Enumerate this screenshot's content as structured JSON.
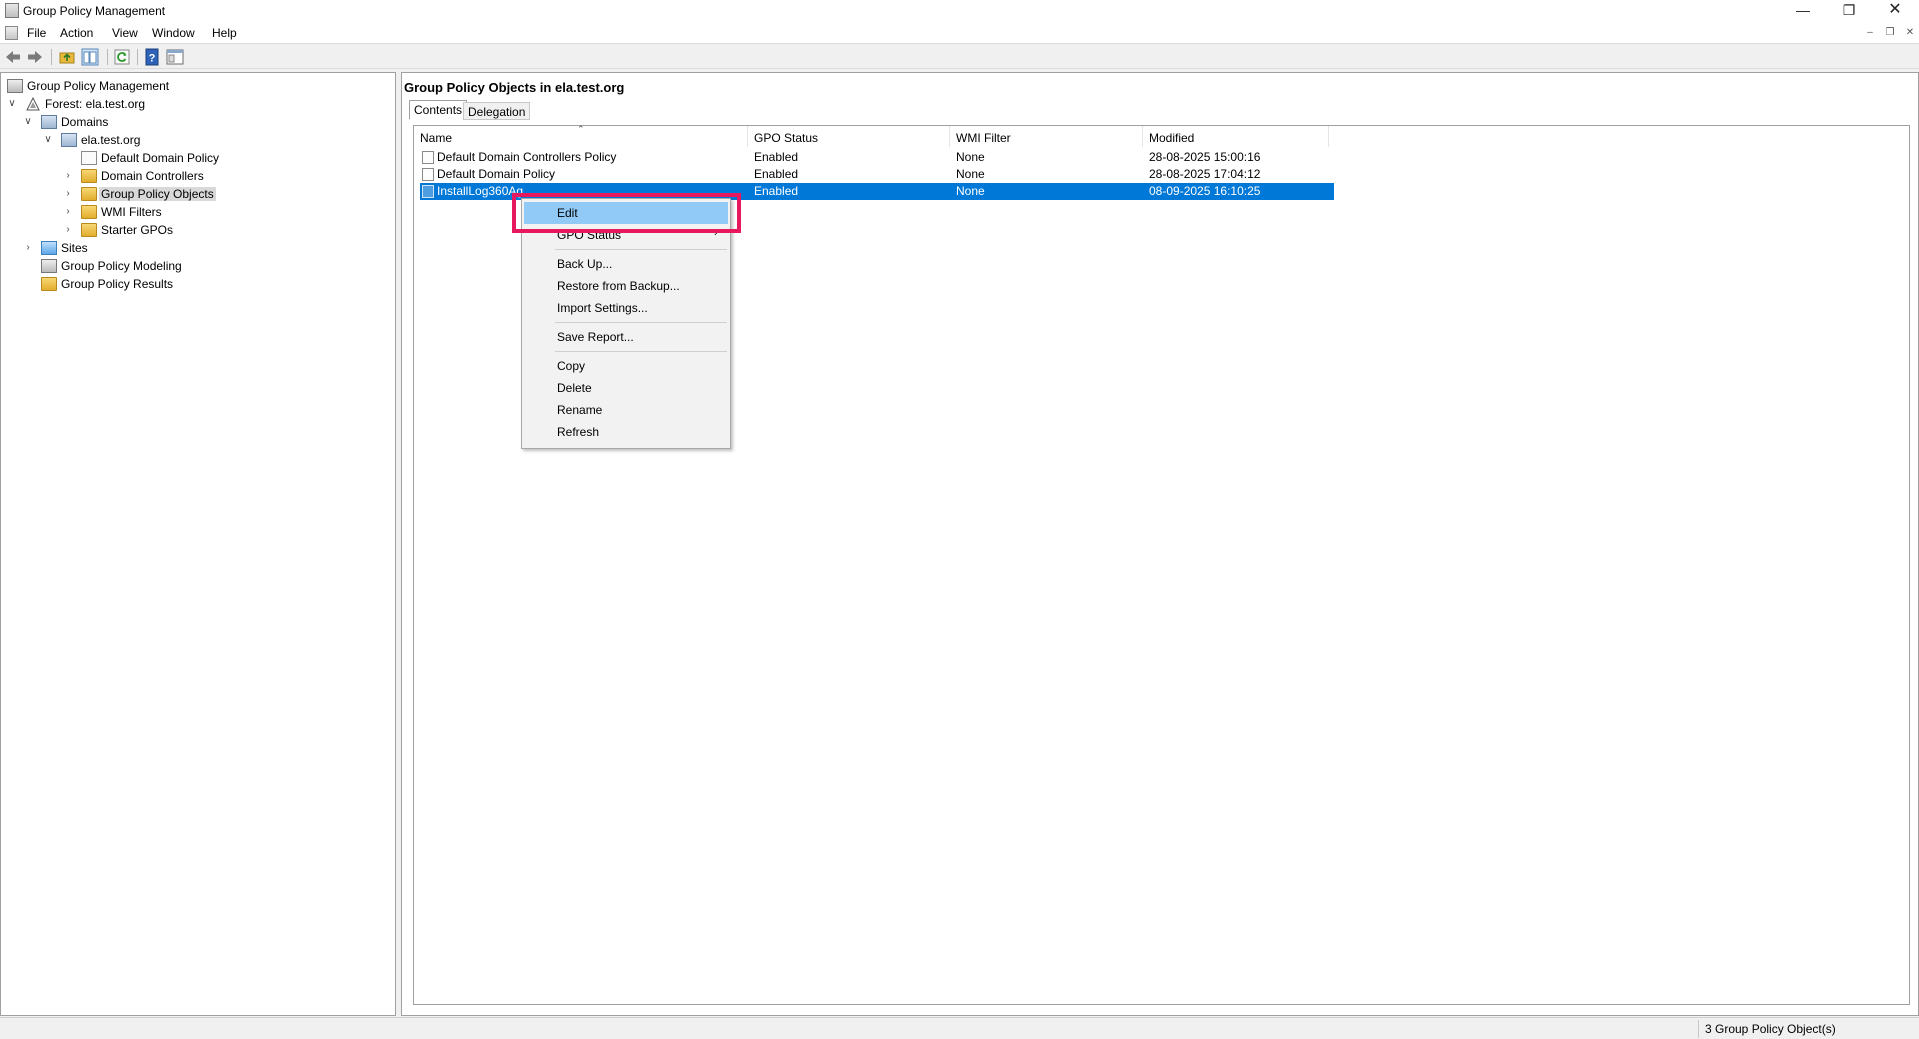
{
  "window": {
    "title": "Group Policy Management"
  },
  "menu": [
    "File",
    "Action",
    "View",
    "Window",
    "Help"
  ],
  "tree": {
    "root": "Group Policy Management",
    "forest": "Forest: ela.test.org",
    "domains": "Domains",
    "domain": "ela.test.org",
    "default_domain_policy": "Default Domain Policy",
    "domain_controllers": "Domain Controllers",
    "group_policy_objects": "Group Policy Objects",
    "wmi_filters": "WMI Filters",
    "starter_gpos": "Starter GPOs",
    "sites": "Sites",
    "modeling": "Group Policy Modeling",
    "results": "Group Policy Results"
  },
  "main": {
    "title": "Group Policy Objects in ela.test.org",
    "tabs": [
      "Contents",
      "Delegation"
    ],
    "columns": [
      "Name",
      "GPO Status",
      "WMI Filter",
      "Modified"
    ],
    "rows": [
      {
        "name": "Default Domain Controllers Policy",
        "status": "Enabled",
        "wmi": "None",
        "modified": "28-08-2025 15:00:16"
      },
      {
        "name": "Default Domain Policy",
        "status": "Enabled",
        "wmi": "None",
        "modified": "28-08-2025 17:04:12"
      },
      {
        "name": "InstallLog360Ag",
        "status": "Enabled",
        "wmi": "None",
        "modified": "08-09-2025 16:10:25"
      }
    ]
  },
  "context_menu": {
    "edit": "Edit",
    "gpo_status": "GPO Status",
    "back_up": "Back Up...",
    "restore": "Restore from Backup...",
    "import": "Import Settings...",
    "save_report": "Save Report...",
    "copy": "Copy",
    "delete": "Delete",
    "rename": "Rename",
    "refresh": "Refresh"
  },
  "status": {
    "count": "3 Group Policy Object(s)"
  },
  "colors": {
    "selection": "#0078d7",
    "menu_hover": "#91c9f7",
    "highlight": "#e8185e"
  }
}
